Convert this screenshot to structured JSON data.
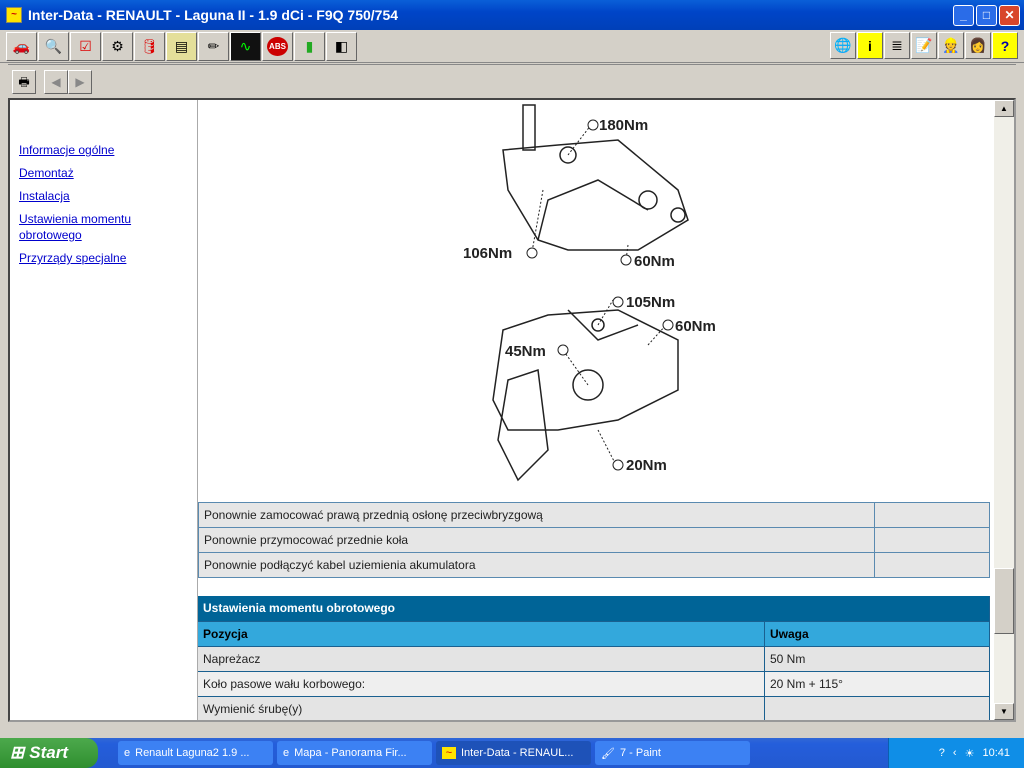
{
  "window": {
    "title": "Inter-Data - RENAULT - Laguna II - 1.9 dCi - F9Q 750/754",
    "min": "_",
    "max": "□",
    "close": "✕"
  },
  "toolbar": {
    "left_icons": [
      "car-icon",
      "info-search-icon",
      "checkbox-icon",
      "timing-icon",
      "oil-icon",
      "engine-icon",
      "pencil-icon",
      "oscilloscope-icon",
      "abs-icon",
      "connector-icon",
      "diagram-icon"
    ],
    "right_icons": [
      "globe-icon",
      "info-icon",
      "list-icon",
      "notes-icon",
      "user-icon",
      "person-icon",
      "help-icon"
    ]
  },
  "nav": {
    "print": "🖶",
    "back": "◀",
    "forward": "▶"
  },
  "sidebar": {
    "links": [
      "Informacje ogólne",
      "Demontaż",
      "Instalacja",
      "Ustawienia momentu obrotowego",
      "Przyrządy specjalne"
    ]
  },
  "diagram": {
    "labels": [
      "180Nm",
      "106Nm",
      "60Nm",
      "105Nm",
      "60Nm",
      "45Nm",
      "20Nm"
    ]
  },
  "steps": [
    [
      "Ponownie zamocować prawą przednią osłonę przeciwbryzgową",
      ""
    ],
    [
      "Ponownie przymocować przednie koła",
      ""
    ],
    [
      "Ponownie podłączyć kabel uziemienia akumulatora",
      ""
    ]
  ],
  "torque": {
    "title": "Ustawienia momentu obrotowego",
    "headers": [
      "Pozycja",
      "Uwaga"
    ],
    "rows": [
      [
        "Napreżacz",
        "50 Nm"
      ],
      [
        "Koło pasowe wału korbowego:",
        "20 Nm + 115°"
      ],
      [
        "Wymienić śrubę(y)",
        ""
      ]
    ]
  },
  "taskbar": {
    "start": "Start",
    "tasks": [
      "Renault Laguna2 1.9 ...",
      "Mapa - Panorama Fir...",
      "Inter-Data - RENAUL...",
      "7 - Paint"
    ],
    "clock": "10:41"
  }
}
